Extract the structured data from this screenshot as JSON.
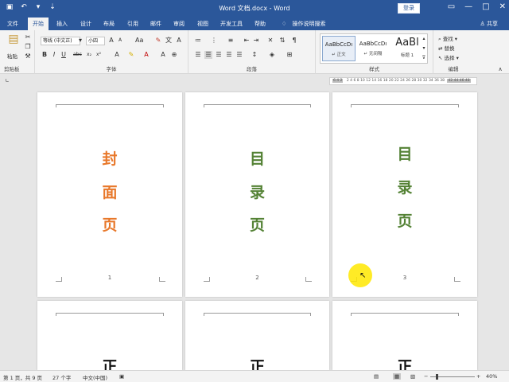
{
  "window": {
    "title": "Word 文档.docx  -  Word",
    "login_label": "登录",
    "share_label": "共享"
  },
  "qat": {
    "save": "▣",
    "undo": "↶",
    "undo_dd": "▾",
    "customize": "⇣"
  },
  "winbtns": {
    "ribbon_opts": "▭",
    "minimize": "—",
    "restore": "□",
    "close": "✕"
  },
  "tabs": [
    "文件",
    "开始",
    "插入",
    "设计",
    "布局",
    "引用",
    "邮件",
    "审阅",
    "视图",
    "开发工具",
    "帮助",
    "操作说明搜索"
  ],
  "ribbon": {
    "clipboard": {
      "paste": "粘贴",
      "label": "剪贴板"
    },
    "font": {
      "font_name": "等线 (中文正)",
      "font_size": "小四",
      "label": "字体"
    },
    "paragraph": {
      "label": "段落"
    },
    "styles": {
      "items": [
        {
          "sample": "AaBbCcDı",
          "name": "↵ 正文"
        },
        {
          "sample": "AaBbCcDı",
          "name": "↵ 无间隔"
        },
        {
          "sample": "AaBl",
          "name": "标题 1"
        }
      ],
      "label": "样式"
    },
    "editing": {
      "find": "查找",
      "replace": "替换",
      "select": "选择",
      "label": "编辑"
    }
  },
  "ruler": {
    "left_marks": "6 4 2",
    "marks": "2  4  6  8 10 12 14 16 18 20 22 24 26 28 30 32 34 36 38",
    "right_marks": "42 44 46 48"
  },
  "pages": [
    {
      "chars": [
        "封",
        "面",
        "页"
      ],
      "number": "1",
      "color": "#e8782a"
    },
    {
      "chars": [
        "目",
        "录",
        "页"
      ],
      "number": "2",
      "color": "#548235"
    },
    {
      "chars": [
        "目",
        "录",
        "页"
      ],
      "number": "3",
      "color": "#548235"
    },
    {
      "chars": [
        "正"
      ],
      "number": ""
    },
    {
      "chars": [
        "正"
      ],
      "number": ""
    },
    {
      "chars": [
        "正"
      ],
      "number": ""
    }
  ],
  "status": {
    "page": "第 1 页，共 9 页",
    "words": "27 个字",
    "lang": "中文(中国)",
    "zoom": "40%"
  }
}
